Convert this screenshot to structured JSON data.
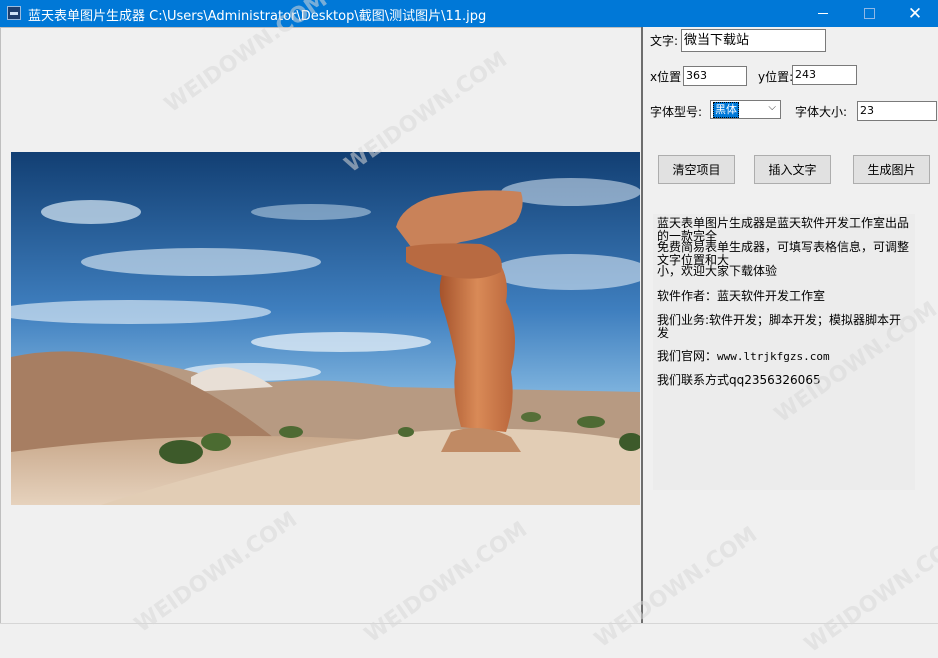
{
  "window": {
    "title": "蓝天表单图片生成器  C:\\Users\\Administrator\\Desktop\\截图\\测试图片\\11.jpg",
    "accent": "#0078d7"
  },
  "form": {
    "text_label": "文字:",
    "text_value": "微当下载站",
    "x_label": "x位置",
    "x_value": "363",
    "y_label": "y位置:",
    "y_value": "243",
    "font_type_label": "字体型号:",
    "font_type_value": "黑体",
    "font_size_label": "字体大小:",
    "font_size_value": "23"
  },
  "buttons": {
    "clear": "清空项目",
    "insert": "插入文字",
    "generate": "生成图片"
  },
  "info": {
    "line1": "蓝天表单图片生成器是蓝天软件开发工作室出品的一款完全",
    "line2": "免费简易表单生成器，可填写表格信息，可调整文字位置和大",
    "line3": "小，欢迎大家下载体验",
    "author": "软件作者：蓝天软件开发工作室",
    "business": "我们业务:软件开发；脚本开发；模拟器脚本开发",
    "website_label": "我们官网：",
    "website": "www.ltrjkfgzs.com",
    "contact": "我们联系方式qq2356326065"
  },
  "watermark": "WEIDOWN.COM"
}
